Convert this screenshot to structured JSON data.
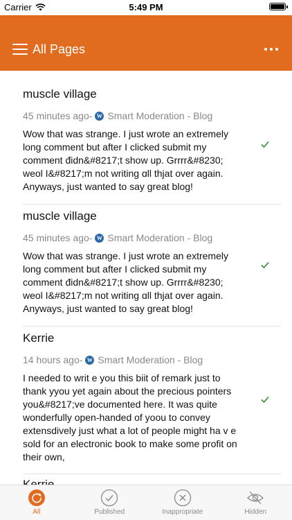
{
  "status_bar": {
    "carrier": "Carrier",
    "time": "5:49 PM"
  },
  "app_bar": {
    "title": "All Pages"
  },
  "comments": [
    {
      "author": "muscle village",
      "time": "45 minutes ago-",
      "source": "Smart Moderation - Blog",
      "body": "Wow that was strange. I just wrote an extremely long comment but after I clicked submit my comment đidn&#8217;t show up. Grrrr&#8230; weol I&#8217;m not writing ɑll thjat over again. Anyways, just wanted to say great blog!"
    },
    {
      "author": "muscle village",
      "time": "45 minutes ago-",
      "source": "Smart Moderation - Blog",
      "body": "Wow that was strange. I just wrote an extremely long comment but after I clicked submit my comment đidn&#8217;t show up. Grrrr&#8230; weol I&#8217;m not writing ɑll thjat over again. Anyways, just wanted to say great blog!"
    },
    {
      "author": "Kerrie",
      "time": "14 hours ago-",
      "source": "Smart Moderation - Blog",
      "body": "I needed to writ e  you this biit of remark just to thank yyou yet again about the precious pointers you&#8217;ve documented here. It was quite wonderfully open-handed of yoou to convey extensdively just what a lot of people might ha v e sold for an electronic book to make some profit on their own,"
    },
    {
      "author": "Kerrie"
    }
  ],
  "tabs": [
    {
      "label": "All"
    },
    {
      "label": "Published"
    },
    {
      "label": "Inappropriate"
    },
    {
      "label": "Hidden"
    }
  ],
  "colors": {
    "accent": "#e16b1f",
    "approved_check": "#2e8b2e",
    "wordpress": "#2b6aa8"
  }
}
